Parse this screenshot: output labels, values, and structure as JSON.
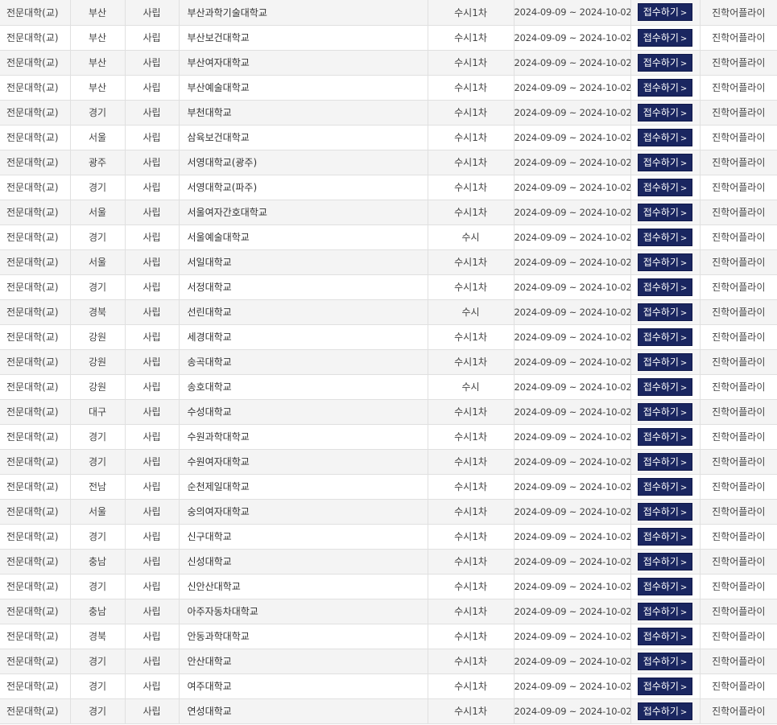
{
  "button_label": "접수하기",
  "button_chevron": ">",
  "rows": [
    {
      "type": "전문대학(교)",
      "region": "부산",
      "founding": "사립",
      "school": "부산과학기술대학교",
      "round": "수시1차",
      "period": "2024-09-09 ~ 2024-10-02",
      "agency": "진학어플라이"
    },
    {
      "type": "전문대학(교)",
      "region": "부산",
      "founding": "사립",
      "school": "부산보건대학교",
      "round": "수시1차",
      "period": "2024-09-09 ~ 2024-10-02",
      "agency": "진학어플라이"
    },
    {
      "type": "전문대학(교)",
      "region": "부산",
      "founding": "사립",
      "school": "부산여자대학교",
      "round": "수시1차",
      "period": "2024-09-09 ~ 2024-10-02",
      "agency": "진학어플라이"
    },
    {
      "type": "전문대학(교)",
      "region": "부산",
      "founding": "사립",
      "school": "부산예술대학교",
      "round": "수시1차",
      "period": "2024-09-09 ~ 2024-10-02",
      "agency": "진학어플라이"
    },
    {
      "type": "전문대학(교)",
      "region": "경기",
      "founding": "사립",
      "school": "부천대학교",
      "round": "수시1차",
      "period": "2024-09-09 ~ 2024-10-02",
      "agency": "진학어플라이"
    },
    {
      "type": "전문대학(교)",
      "region": "서울",
      "founding": "사립",
      "school": "삼육보건대학교",
      "round": "수시1차",
      "period": "2024-09-09 ~ 2024-10-02",
      "agency": "진학어플라이"
    },
    {
      "type": "전문대학(교)",
      "region": "광주",
      "founding": "사립",
      "school": "서영대학교(광주)",
      "round": "수시1차",
      "period": "2024-09-09 ~ 2024-10-02",
      "agency": "진학어플라이"
    },
    {
      "type": "전문대학(교)",
      "region": "경기",
      "founding": "사립",
      "school": "서영대학교(파주)",
      "round": "수시1차",
      "period": "2024-09-09 ~ 2024-10-02",
      "agency": "진학어플라이"
    },
    {
      "type": "전문대학(교)",
      "region": "서울",
      "founding": "사립",
      "school": "서울여자간호대학교",
      "round": "수시1차",
      "period": "2024-09-09 ~ 2024-10-02",
      "agency": "진학어플라이"
    },
    {
      "type": "전문대학(교)",
      "region": "경기",
      "founding": "사립",
      "school": "서울예술대학교",
      "round": "수시",
      "period": "2024-09-09 ~ 2024-10-02",
      "agency": "진학어플라이"
    },
    {
      "type": "전문대학(교)",
      "region": "서울",
      "founding": "사립",
      "school": "서일대학교",
      "round": "수시1차",
      "period": "2024-09-09 ~ 2024-10-02",
      "agency": "진학어플라이"
    },
    {
      "type": "전문대학(교)",
      "region": "경기",
      "founding": "사립",
      "school": "서정대학교",
      "round": "수시1차",
      "period": "2024-09-09 ~ 2024-10-02",
      "agency": "진학어플라이"
    },
    {
      "type": "전문대학(교)",
      "region": "경북",
      "founding": "사립",
      "school": "선린대학교",
      "round": "수시",
      "period": "2024-09-09 ~ 2024-10-02",
      "agency": "진학어플라이"
    },
    {
      "type": "전문대학(교)",
      "region": "강원",
      "founding": "사립",
      "school": "세경대학교",
      "round": "수시1차",
      "period": "2024-09-09 ~ 2024-10-02",
      "agency": "진학어플라이"
    },
    {
      "type": "전문대학(교)",
      "region": "강원",
      "founding": "사립",
      "school": "송곡대학교",
      "round": "수시1차",
      "period": "2024-09-09 ~ 2024-10-02",
      "agency": "진학어플라이"
    },
    {
      "type": "전문대학(교)",
      "region": "강원",
      "founding": "사립",
      "school": "송호대학교",
      "round": "수시",
      "period": "2024-09-09 ~ 2024-10-02",
      "agency": "진학어플라이"
    },
    {
      "type": "전문대학(교)",
      "region": "대구",
      "founding": "사립",
      "school": "수성대학교",
      "round": "수시1차",
      "period": "2024-09-09 ~ 2024-10-02",
      "agency": "진학어플라이"
    },
    {
      "type": "전문대학(교)",
      "region": "경기",
      "founding": "사립",
      "school": "수원과학대학교",
      "round": "수시1차",
      "period": "2024-09-09 ~ 2024-10-02",
      "agency": "진학어플라이"
    },
    {
      "type": "전문대학(교)",
      "region": "경기",
      "founding": "사립",
      "school": "수원여자대학교",
      "round": "수시1차",
      "period": "2024-09-09 ~ 2024-10-02",
      "agency": "진학어플라이"
    },
    {
      "type": "전문대학(교)",
      "region": "전남",
      "founding": "사립",
      "school": "순천제일대학교",
      "round": "수시1차",
      "period": "2024-09-09 ~ 2024-10-02",
      "agency": "진학어플라이"
    },
    {
      "type": "전문대학(교)",
      "region": "서울",
      "founding": "사립",
      "school": "숭의여자대학교",
      "round": "수시1차",
      "period": "2024-09-09 ~ 2024-10-02",
      "agency": "진학어플라이"
    },
    {
      "type": "전문대학(교)",
      "region": "경기",
      "founding": "사립",
      "school": "신구대학교",
      "round": "수시1차",
      "period": "2024-09-09 ~ 2024-10-02",
      "agency": "진학어플라이"
    },
    {
      "type": "전문대학(교)",
      "region": "충남",
      "founding": "사립",
      "school": "신성대학교",
      "round": "수시1차",
      "period": "2024-09-09 ~ 2024-10-02",
      "agency": "진학어플라이"
    },
    {
      "type": "전문대학(교)",
      "region": "경기",
      "founding": "사립",
      "school": "신안산대학교",
      "round": "수시1차",
      "period": "2024-09-09 ~ 2024-10-02",
      "agency": "진학어플라이"
    },
    {
      "type": "전문대학(교)",
      "region": "충남",
      "founding": "사립",
      "school": "아주자동차대학교",
      "round": "수시1차",
      "period": "2024-09-09 ~ 2024-10-02",
      "agency": "진학어플라이"
    },
    {
      "type": "전문대학(교)",
      "region": "경북",
      "founding": "사립",
      "school": "안동과학대학교",
      "round": "수시1차",
      "period": "2024-09-09 ~ 2024-10-02",
      "agency": "진학어플라이"
    },
    {
      "type": "전문대학(교)",
      "region": "경기",
      "founding": "사립",
      "school": "안산대학교",
      "round": "수시1차",
      "period": "2024-09-09 ~ 2024-10-02",
      "agency": "진학어플라이"
    },
    {
      "type": "전문대학(교)",
      "region": "경기",
      "founding": "사립",
      "school": "여주대학교",
      "round": "수시1차",
      "period": "2024-09-09 ~ 2024-10-02",
      "agency": "진학어플라이"
    },
    {
      "type": "전문대학(교)",
      "region": "경기",
      "founding": "사립",
      "school": "연성대학교",
      "round": "수시1차",
      "period": "2024-09-09 ~ 2024-10-02",
      "agency": "진학어플라이"
    }
  ]
}
